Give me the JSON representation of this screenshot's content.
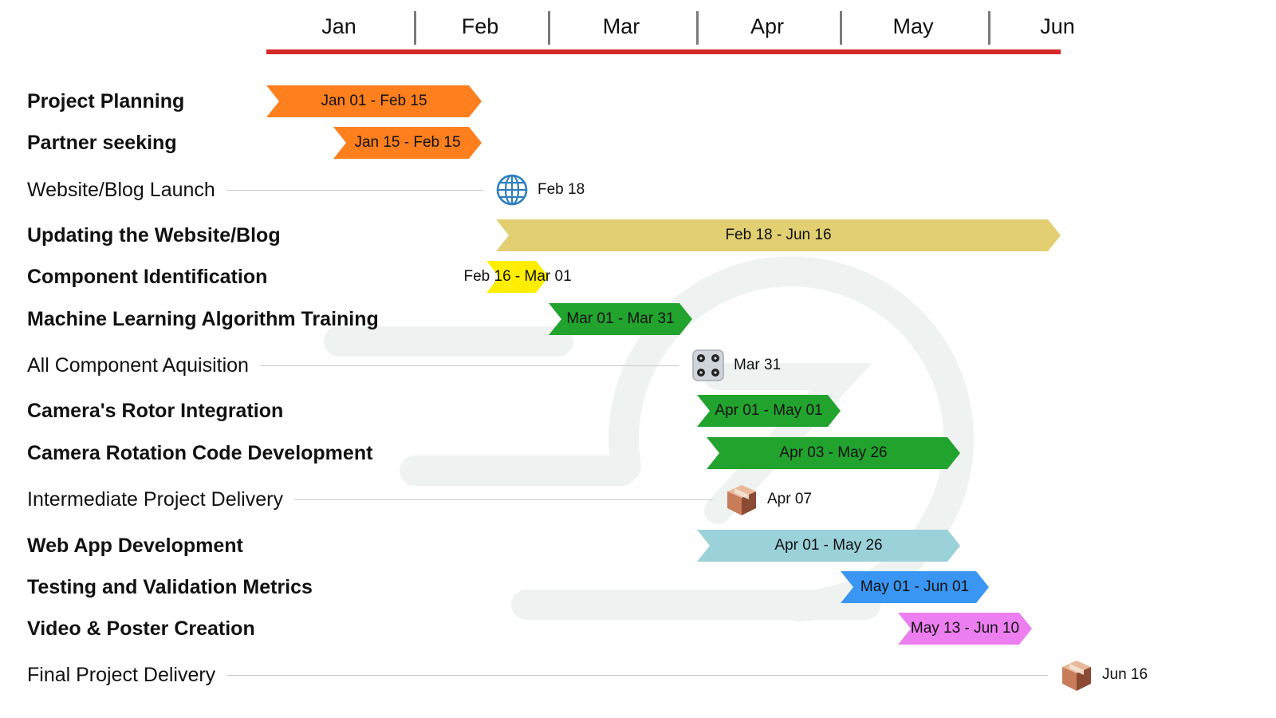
{
  "chart_data": {
    "type": "gantt",
    "months": [
      "Jan",
      "Feb",
      "Mar",
      "Apr",
      "May",
      "Jun"
    ],
    "year_days": {
      "Jan": 0,
      "Feb": 31,
      "Mar": 59,
      "Apr": 90,
      "May": 120,
      "Jun": 151
    },
    "axis_line_color": "#d62828",
    "tasks": [
      {
        "name": "Project Planning",
        "kind": "bar",
        "bold": true,
        "start": "Jan 01",
        "end": "Feb 15",
        "label": "Jan 01 - Feb 15",
        "color": "#fd7f1e"
      },
      {
        "name": "Partner seeking",
        "kind": "bar",
        "bold": true,
        "start": "Jan 15",
        "end": "Feb 15",
        "label": "Jan 15 - Feb 15",
        "color": "#fd7f1e"
      },
      {
        "name": "Website/Blog Launch",
        "kind": "milestone",
        "bold": false,
        "date": "Feb 18",
        "label": "Feb 18",
        "icon": "globe-icon"
      },
      {
        "name": "Updating the Website/Blog",
        "kind": "bar",
        "bold": true,
        "start": "Feb 18",
        "end": "Jun 16",
        "label": "Feb 18 - Jun 16",
        "color": "#e2cf72"
      },
      {
        "name": "Component Identification",
        "kind": "bar",
        "bold": true,
        "start": "Feb 16",
        "end": "Mar 01",
        "label": "Feb 16 - Mar 01",
        "color": "#ffee00",
        "label_outside": true
      },
      {
        "name": "Machine Learning Algorithm Training",
        "kind": "bar",
        "bold": true,
        "start": "Mar 01",
        "end": "Mar 31",
        "label": "Mar 01 - Mar 31",
        "color": "#22a32e"
      },
      {
        "name": "All Component Aquisition",
        "kind": "milestone",
        "bold": false,
        "date": "Mar 31",
        "label": "Mar 31",
        "icon": "components-icon"
      },
      {
        "name": "Camera's Rotor Integration",
        "kind": "bar",
        "bold": true,
        "start": "Apr 01",
        "end": "May 01",
        "label": "Apr 01 - May 01",
        "color": "#22a32e"
      },
      {
        "name": "Camera Rotation Code Development",
        "kind": "bar",
        "bold": true,
        "start": "Apr 03",
        "end": "May 26",
        "label": "Apr 03 - May 26",
        "color": "#22a32e"
      },
      {
        "name": "Intermediate Project Delivery",
        "kind": "milestone",
        "bold": false,
        "date": "Apr 07",
        "label": "Apr 07",
        "icon": "package-icon"
      },
      {
        "name": "Web App Development",
        "kind": "bar",
        "bold": true,
        "start": "Apr 01",
        "end": "May 26",
        "label": "Apr 01 - May 26",
        "color": "#9bd1d9"
      },
      {
        "name": "Testing and Validation Metrics",
        "kind": "bar",
        "bold": true,
        "start": "May 01",
        "end": "Jun 01",
        "label": "May 01 - Jun 01",
        "color": "#3a96f2"
      },
      {
        "name": "Video & Poster Creation",
        "kind": "bar",
        "bold": true,
        "start": "May 13",
        "end": "Jun 10",
        "label": "May 13 - Jun 10",
        "color": "#ec7ef0"
      },
      {
        "name": "Final Project Delivery",
        "kind": "milestone",
        "bold": false,
        "date": "Jun 16",
        "label": "Jun 16",
        "icon": "package-icon"
      }
    ]
  }
}
